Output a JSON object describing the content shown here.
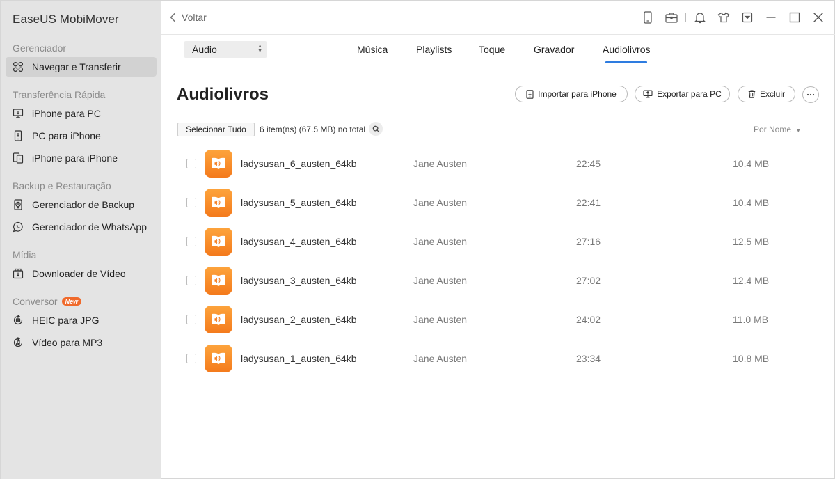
{
  "app_title": "EaseUS MobiMover",
  "sidebar": {
    "sections": [
      {
        "label": "Gerenciador"
      },
      {
        "label": "Transferência Rápida"
      },
      {
        "label": "Backup e Restauração"
      },
      {
        "label": "Mídia"
      },
      {
        "label": "Conversor",
        "badge": "New"
      }
    ],
    "items": [
      {
        "label": "Navegar e Transferir",
        "icon": "grid-icon",
        "active": true
      },
      {
        "label": "iPhone para PC",
        "icon": "phone-to-pc-icon"
      },
      {
        "label": "PC para iPhone",
        "icon": "pc-to-phone-icon"
      },
      {
        "label": "iPhone para iPhone",
        "icon": "phone-to-phone-icon"
      },
      {
        "label": "Gerenciador de Backup",
        "icon": "backup-icon"
      },
      {
        "label": "Gerenciador de WhatsApp",
        "icon": "whatsapp-icon"
      },
      {
        "label": "Downloader de Vídeo",
        "icon": "video-download-icon"
      },
      {
        "label": "HEIC para JPG",
        "icon": "image-convert-icon"
      },
      {
        "label": "Vídeo para MP3",
        "icon": "audio-convert-icon"
      }
    ]
  },
  "topbar": {
    "back_label": "Voltar",
    "icons": [
      "phone-icon",
      "toolbox-icon",
      "bell-icon",
      "shirt-icon",
      "dropdown-menu-icon",
      "minimize-icon",
      "maximize-icon",
      "close-icon"
    ]
  },
  "tabbar": {
    "category_select": "Áudio",
    "tabs": [
      {
        "label": "Música"
      },
      {
        "label": "Playlists"
      },
      {
        "label": "Toque"
      },
      {
        "label": "Gravador"
      },
      {
        "label": "Audiolivros",
        "active": true
      }
    ]
  },
  "main": {
    "title": "Audiolivros",
    "actions": {
      "import": "Importar para iPhone",
      "export": "Exportar para PC",
      "delete": "Excluir"
    },
    "select_all": "Selecionar Tudo",
    "count_text": "6 item(ns) (67.5 MB) no total",
    "sort_label": "Por Nome",
    "rows": [
      {
        "name": "ladysusan_6_austen_64kb",
        "artist": "Jane Austen",
        "duration": "22:45",
        "size": "10.4 MB"
      },
      {
        "name": "ladysusan_5_austen_64kb",
        "artist": "Jane Austen",
        "duration": "22:41",
        "size": "10.4 MB"
      },
      {
        "name": "ladysusan_4_austen_64kb",
        "artist": "Jane Austen",
        "duration": "27:16",
        "size": "12.5 MB"
      },
      {
        "name": "ladysusan_3_austen_64kb",
        "artist": "Jane Austen",
        "duration": "27:02",
        "size": "12.4 MB"
      },
      {
        "name": "ladysusan_2_austen_64kb",
        "artist": "Jane Austen",
        "duration": "24:02",
        "size": "11.0 MB"
      },
      {
        "name": "ladysusan_1_austen_64kb",
        "artist": "Jane Austen",
        "duration": "23:34",
        "size": "10.8 MB"
      }
    ]
  },
  "colors": {
    "accent": "#2e7ce0",
    "sidebar_bg": "#e4e4e4",
    "thumb_orange": "#f47a1c",
    "badge_orange": "#f06a2b"
  }
}
